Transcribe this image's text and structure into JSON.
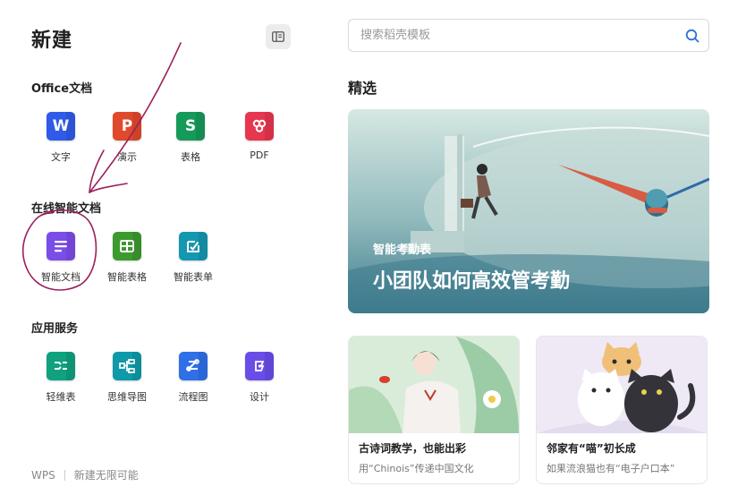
{
  "header": {
    "title": "新建"
  },
  "sections": {
    "office": {
      "title": "Office文档",
      "items": [
        {
          "label": "文字",
          "glyph": "W",
          "color": "#2f5be8"
        },
        {
          "label": "演示",
          "glyph": "P",
          "color": "#e0492c"
        },
        {
          "label": "表格",
          "glyph": "S",
          "color": "#169a5a"
        },
        {
          "label": "PDF",
          "glyph": "",
          "color": "#e7364f"
        }
      ]
    },
    "online": {
      "title": "在线智能文档",
      "items": [
        {
          "label": "智能文档",
          "color": "#7b4de8"
        },
        {
          "label": "智能表格",
          "color": "#3c9a2e"
        },
        {
          "label": "智能表单",
          "color": "#1497b0"
        }
      ]
    },
    "apps": {
      "title": "应用服务",
      "items": [
        {
          "label": "轻维表",
          "color": "#10a17f"
        },
        {
          "label": "思维导图",
          "color": "#0e9aa8"
        },
        {
          "label": "流程图",
          "color": "#2f6fe8"
        },
        {
          "label": "设计",
          "color": "#6a4de8"
        }
      ]
    }
  },
  "footer": {
    "brand": "WPS",
    "slogan": "新建无限可能"
  },
  "search": {
    "placeholder": "搜索稻壳模板"
  },
  "featured": {
    "title": "精选",
    "banner": {
      "subtitle": "智能考勤表",
      "title": "小团队如何高效管考勤"
    },
    "cards": [
      {
        "title": "古诗词教学，也能出彩",
        "desc": "用“Chinois”传递中国文化"
      },
      {
        "title": "邻家有“喵”初长成",
        "desc": "如果流浪猫也有“电子户口本”"
      }
    ]
  }
}
